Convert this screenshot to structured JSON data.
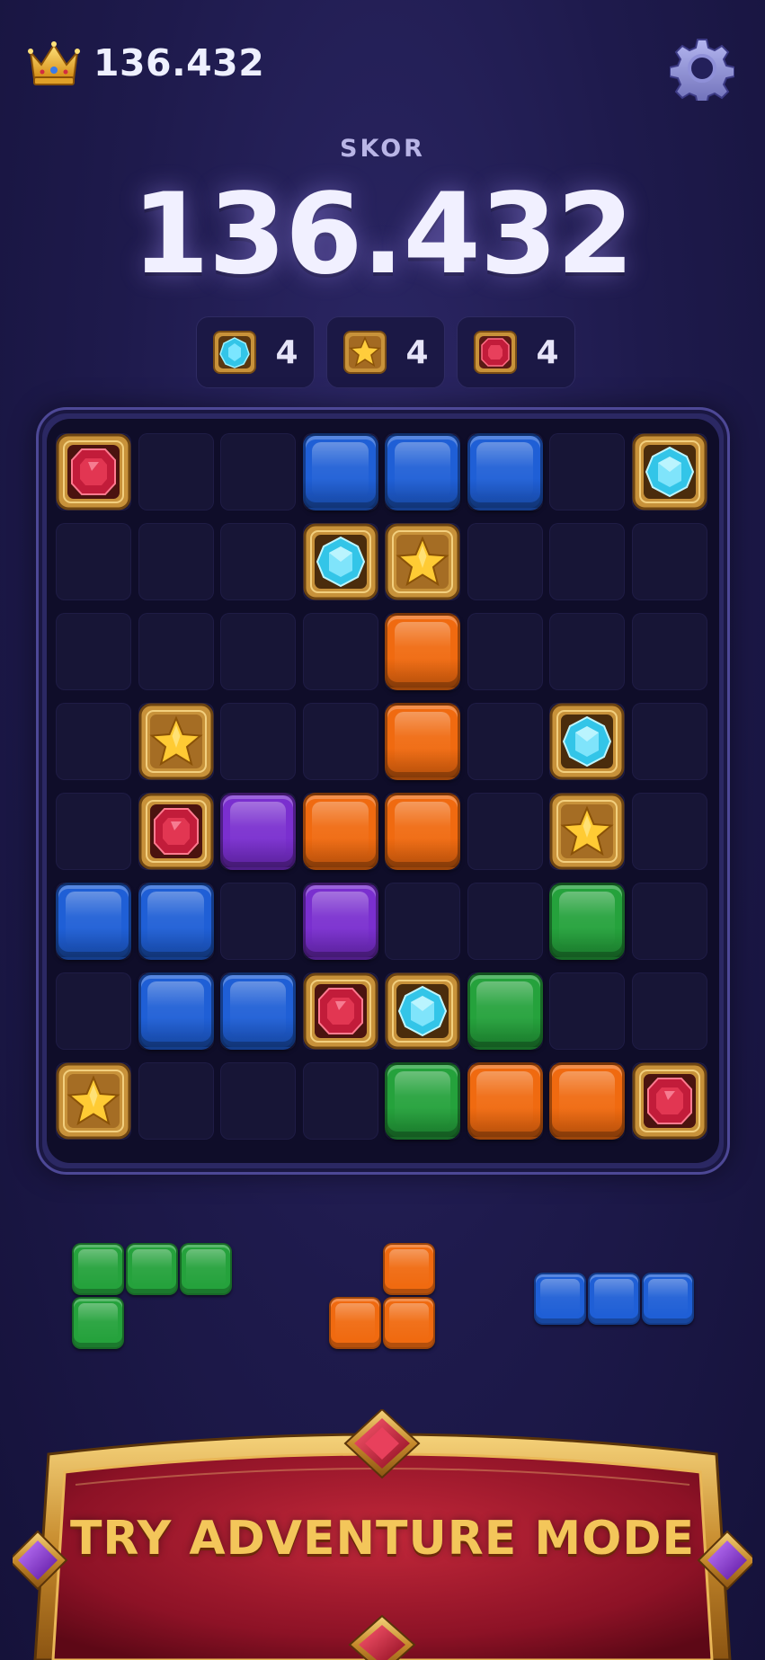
{
  "header": {
    "best_score": "136.432",
    "settings_icon": "gear-icon",
    "crown_icon": "crown-icon"
  },
  "score": {
    "label": "SKOR",
    "value": "136.432"
  },
  "goals": [
    {
      "icon": "blue-diamond-icon",
      "count": "4"
    },
    {
      "icon": "gold-star-icon",
      "count": "4"
    },
    {
      "icon": "red-ruby-icon",
      "count": "4"
    }
  ],
  "colors": {
    "blue": "#1f5fd6",
    "orange": "#f06a10",
    "purple": "#7a2fcf",
    "green": "#25a23c",
    "gold": "#c8923a",
    "ruby": "#c21c3a",
    "diamond": "#33c5e8",
    "button_text": "#f3c65a"
  },
  "board": {
    "rows": 8,
    "cols": 8,
    "cells": [
      [
        "ruby",
        "",
        "",
        "blue",
        "blue",
        "blue",
        "",
        "diamond"
      ],
      [
        "",
        "",
        "",
        "diamond",
        "star",
        "",
        "",
        ""
      ],
      [
        "",
        "",
        "",
        "",
        "orange",
        "",
        "",
        ""
      ],
      [
        "",
        "star",
        "",
        "",
        "orange",
        "",
        "diamond",
        ""
      ],
      [
        "",
        "ruby",
        "purple",
        "orange",
        "orange",
        "",
        "star",
        ""
      ],
      [
        "blue",
        "blue",
        "",
        "purple",
        "",
        "",
        "green",
        ""
      ],
      [
        "",
        "blue",
        "blue",
        "ruby",
        "diamond",
        "green",
        "",
        ""
      ],
      [
        "star",
        "",
        "",
        "",
        "green",
        "orange",
        "orange",
        "ruby"
      ]
    ]
  },
  "pieces": [
    {
      "color": "green",
      "shape": [
        [
          1,
          1,
          1
        ],
        [
          1,
          0,
          0
        ]
      ]
    },
    {
      "color": "orange",
      "shape": [
        [
          0,
          1
        ],
        [
          1,
          1
        ]
      ]
    },
    {
      "color": "blue",
      "shape": [
        [
          1,
          1,
          1
        ]
      ]
    }
  ],
  "adventure_button": {
    "label": "TRY ADVENTURE MODE"
  }
}
